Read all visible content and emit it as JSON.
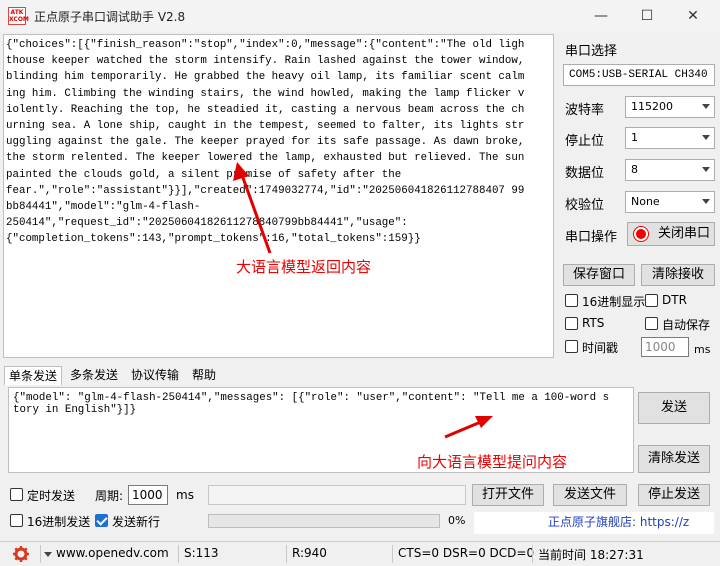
{
  "window": {
    "logo_line1": "ATK",
    "logo_line2": "XCOM",
    "title": "正点原子串口调试助手 V2.8",
    "min_symbol": "—",
    "max_symbol": "☐",
    "close_symbol": "✕"
  },
  "receive": {
    "text": "{\"choices\":[{\"finish_reason\":\"stop\",\"index\":0,\"message\":{\"content\":\"The old lighthouse keeper watched the storm intensify. Rain lashed against the tower window, blinding him temporarily. He grabbed the heavy oil lamp, its familiar scent calming him. Climbing the winding stairs, the wind howled, making the lamp flicker violently. Reaching the top, he steadied it, casting a nervous beam across the churning sea. A lone ship, caught in the tempest, seemed to falter, its lights struggling against the gale. The keeper prayed for its safe passage. As dawn broke, the storm relented. The keeper lowered the lamp, exhausted but relieved. The sun painted the clouds gold, a silent promise of safety after the\nfear.\",\"role\":\"assistant\"}}],\"created\":1749032774,\"id\":\"202506041826112788407 99bb84441\",\"model\":\"glm-4-flash-\n250414\",\"request_id\":\"20250604182611278840799bb84441\",\"usage\":\n{\"completion_tokens\":143,\"prompt_tokens\":16,\"total_tokens\":159}}",
    "annotation": "大语言模型返回内容"
  },
  "right_panel": {
    "port_select_label": "串口选择",
    "port_value": "COM5:USB-SERIAL CH340",
    "baud_label": "波特率",
    "baud_value": "115200",
    "stop_label": "停止位",
    "stop_value": "1",
    "data_label": "数据位",
    "data_value": "8",
    "parity_label": "校验位",
    "parity_value": "None",
    "port_op_label": "串口操作",
    "close_port_button": "关闭串口",
    "save_window_button": "保存窗口",
    "clear_receive_button": "清除接收",
    "hex_display_label": "16进制显示",
    "dtr_label": "DTR",
    "rts_label": "RTS",
    "auto_save_label": "自动保存",
    "timestamp_label": "时间戳",
    "timestamp_value": "1000",
    "timestamp_unit": "ms"
  },
  "tabs": [
    "单条发送",
    "多条发送",
    "协议传输",
    "帮助"
  ],
  "send": {
    "text": "{\"model\": \"glm-4-flash-250414\",\"messages\": [{\"role\": \"user\",\"content\": \"Tell me a 100-word story in English\"}]}",
    "annotation": "向大语言模型提问内容",
    "send_button": "发送",
    "clear_send_button": "清除发送"
  },
  "bottom": {
    "timed_send_label": "定时发送",
    "period_label": "周期:",
    "period_value": "1000",
    "period_unit": "ms",
    "open_file_button": "打开文件",
    "send_file_button": "发送文件",
    "stop_send_button": "停止发送",
    "hex_send_label": "16进制发送",
    "send_newline_label": "发送新行",
    "progress_text": "0%",
    "progress": 0,
    "store_link": "正点原子旗舰店: https://z"
  },
  "statusbar": {
    "website": "www.openedv.com",
    "sent": "S:113",
    "received": "R:940",
    "signals": "CTS=0 DSR=0 DCD=0",
    "time": "当前时间 18:27:31"
  },
  "colors": {
    "annotation": "#e00000",
    "link": "#1f3fbf",
    "checkbox_checked": "#1f6fd0"
  }
}
